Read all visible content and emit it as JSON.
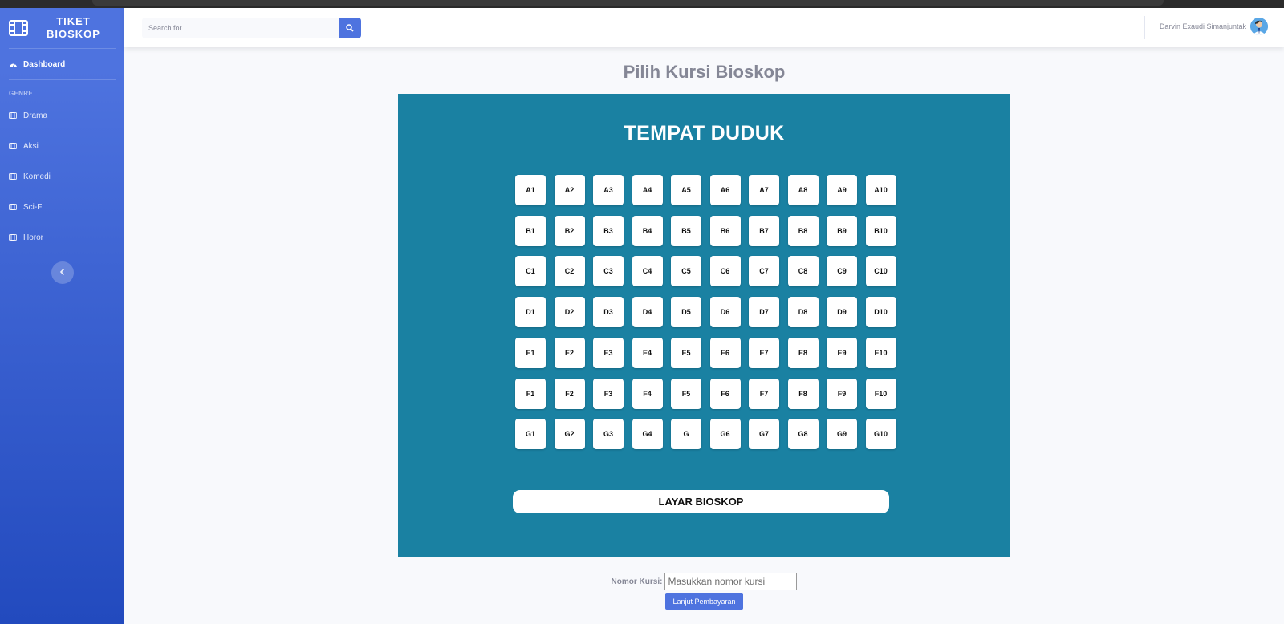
{
  "brand": {
    "line1": "TIKET",
    "line2": "BIOSKOP",
    "icon": "film-icon"
  },
  "sidebar": {
    "dashboard_label": "Dashboard",
    "heading": "GENRE",
    "items": [
      {
        "label": "Drama",
        "icon": "film-icon"
      },
      {
        "label": "Aksi",
        "icon": "film-icon"
      },
      {
        "label": "Komedi",
        "icon": "film-icon"
      },
      {
        "label": "Sci-Fi",
        "icon": "film-icon"
      },
      {
        "label": "Horor",
        "icon": "film-icon"
      }
    ]
  },
  "topbar": {
    "search_placeholder": "Search for...",
    "user_name": "Darvin Exaudi Simanjuntak"
  },
  "page": {
    "title": "Pilih Kursi Bioskop"
  },
  "cinema": {
    "title": "TEMPAT DUDUK",
    "screen_label": "LAYAR BIOSKOP",
    "rows": [
      [
        "A1",
        "A2",
        "A3",
        "A4",
        "A5",
        "A6",
        "A7",
        "A8",
        "A9",
        "A10"
      ],
      [
        "B1",
        "B2",
        "B3",
        "B4",
        "B5",
        "B6",
        "B7",
        "B8",
        "B9",
        "B10"
      ],
      [
        "C1",
        "C2",
        "C3",
        "C4",
        "C5",
        "C6",
        "C7",
        "C8",
        "C9",
        "C10"
      ],
      [
        "D1",
        "D2",
        "D3",
        "D4",
        "D5",
        "D6",
        "D7",
        "D8",
        "D9",
        "D10"
      ],
      [
        "E1",
        "E2",
        "E3",
        "E4",
        "E5",
        "E6",
        "E7",
        "E8",
        "E9",
        "E10"
      ],
      [
        "F1",
        "F2",
        "F3",
        "F4",
        "F5",
        "F6",
        "F7",
        "F8",
        "F9",
        "F10"
      ],
      [
        "G1",
        "G2",
        "G3",
        "G4",
        "G",
        "G6",
        "G7",
        "G8",
        "G9",
        "G10"
      ]
    ]
  },
  "form": {
    "label": "Nomor Kursi:",
    "placeholder": "Masukkan nomor kursi",
    "submit_label": "Lanjut Pembayaran"
  },
  "colors": {
    "accent": "#4e73df",
    "cinema_bg": "#1a81a2",
    "page_bg": "#f8f9fc"
  }
}
